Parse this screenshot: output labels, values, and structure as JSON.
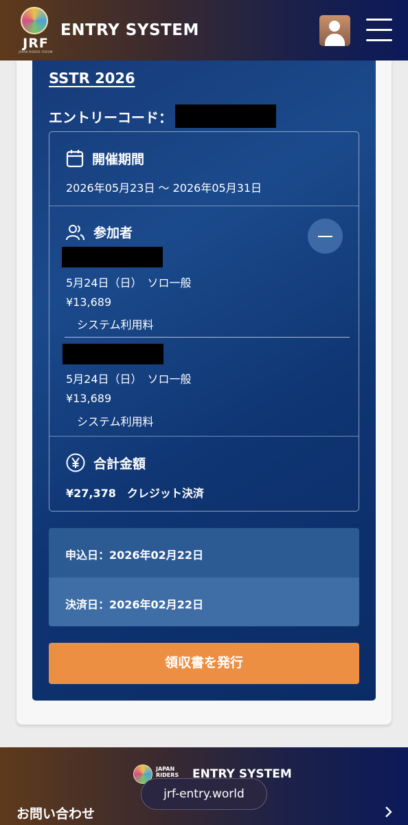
{
  "header": {
    "logo_text": "JRF",
    "logo_subtext": "JAPAN RIDERS FORUM",
    "brand": "ENTRY SYSTEM"
  },
  "entry": {
    "event_title": "SSTR 2026",
    "code_label": "エントリーコード："
  },
  "period": {
    "title": "開催期間",
    "range": "2026年05月23日 〜 2026年05月31日"
  },
  "participants": {
    "title": "参加者",
    "items": [
      {
        "detail": "5月24日（日）　ソロ一般",
        "price": "¥13,689",
        "fee": "システム利用料"
      },
      {
        "detail": "5月24日（日）　ソロ一般",
        "price": "¥13,689",
        "fee": "システム利用料"
      }
    ]
  },
  "total": {
    "title": "合計金額",
    "value": "¥27,378　クレジット決済"
  },
  "dates": {
    "applied": "申込日：2026年02月22日",
    "paid": "決済日：2026年02月22日"
  },
  "receipt_button": "領収書を発行",
  "footer": {
    "logo_line1": "JAPAN",
    "logo_line2": "RIDERS",
    "brand": "ENTRY SYSTEM",
    "url": "jrf-entry.world",
    "contact": "お問い合わせ"
  },
  "colors": {
    "panel": "#163a78",
    "button": "#ec8f42"
  }
}
